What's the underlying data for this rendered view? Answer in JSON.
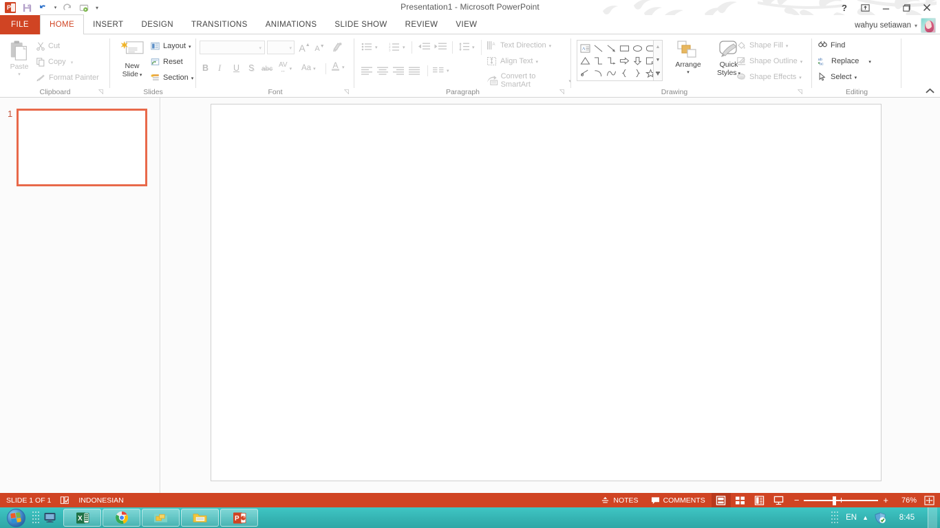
{
  "window": {
    "title": "Presentation1 - Microsoft PowerPoint",
    "app_icon": "powerpoint-icon",
    "help_icon": "?",
    "ribbon_display_icon": "ribbon-display-options-icon",
    "minimize_icon": "minimize-icon",
    "restore_icon": "restore-icon",
    "close_icon": "close-icon",
    "accent_color": "#d04423",
    "taskbar_color": "#36b5b4"
  },
  "quick_access": {
    "items": [
      {
        "name": "save-icon",
        "label": "Save"
      },
      {
        "name": "undo-icon",
        "label": "Undo"
      },
      {
        "name": "undo-dropdown-icon",
        "label": "Undo options"
      },
      {
        "name": "redo-icon",
        "label": "Redo"
      },
      {
        "name": "start-slideshow-icon",
        "label": "Start From Beginning"
      },
      {
        "name": "customize-qat-icon",
        "label": "Customize Quick Access Toolbar"
      }
    ]
  },
  "account": {
    "user_name": "wahyu setiawan",
    "caret": "▾",
    "avatar": "user-avatar"
  },
  "tabs": {
    "file": "FILE",
    "items": [
      {
        "label": "HOME",
        "active": true
      },
      {
        "label": "INSERT",
        "active": false
      },
      {
        "label": "DESIGN",
        "active": false
      },
      {
        "label": "TRANSITIONS",
        "active": false
      },
      {
        "label": "ANIMATIONS",
        "active": false
      },
      {
        "label": "SLIDE SHOW",
        "active": false
      },
      {
        "label": "REVIEW",
        "active": false
      },
      {
        "label": "VIEW",
        "active": false
      }
    ]
  },
  "ribbon": {
    "collapse_icon": "collapse-ribbon-icon",
    "clipboard": {
      "label": "Clipboard",
      "paste": "Paste",
      "cut": "Cut",
      "copy": "Copy",
      "format_painter": "Format Painter"
    },
    "slides": {
      "label": "Slides",
      "new_slide_line1": "New",
      "new_slide_line2": "Slide",
      "layout": "Layout",
      "reset": "Reset",
      "section": "Section"
    },
    "font": {
      "label": "Font",
      "font_name_value": "",
      "font_size_value": "",
      "grow_font": "A",
      "shrink_font": "A",
      "clear_formatting": "clear-formatting-icon",
      "bold": "B",
      "italic": "I",
      "underline": "U",
      "shadow": "S",
      "strikethrough": "abc",
      "character_spacing": "AV",
      "change_case": "Aa",
      "font_color": "A"
    },
    "paragraph": {
      "label": "Paragraph",
      "bullets": "bullets-icon",
      "numbering": "numbering-icon",
      "decrease_indent": "decrease-indent-icon",
      "increase_indent": "increase-indent-icon",
      "line_spacing": "line-spacing-icon",
      "align_left": "align-left-icon",
      "align_center": "align-center-icon",
      "align_right": "align-right-icon",
      "justify": "justify-icon",
      "columns": "columns-icon",
      "text_direction": "Text Direction",
      "align_text": "Align Text",
      "convert_smartart": "Convert to SmartArt"
    },
    "drawing": {
      "label": "Drawing",
      "shapes": [
        "textbox-shape",
        "line-shape",
        "arrow-shape",
        "rectangle-shape",
        "oval-shape",
        "rounded-rectangle-shape",
        "triangle-shape",
        "elbow-connector-shape",
        "elbow-arrow-shape",
        "right-arrow-shape",
        "down-arrow-shape",
        "folded-corner-shape",
        "scribble-shape",
        "arc-shape",
        "curve-shape",
        "left-brace-shape",
        "right-brace-shape",
        "star-shape"
      ],
      "scroll_up_icon": "gallery-scroll-up-icon",
      "scroll_down_icon": "gallery-scroll-down-icon",
      "gallery_more_icon": "gallery-more-icon",
      "arrange": "Arrange",
      "quick_styles_line1": "Quick",
      "quick_styles_line2": "Styles",
      "shape_fill": "Shape Fill",
      "shape_outline": "Shape Outline",
      "shape_effects": "Shape Effects"
    },
    "editing": {
      "label": "Editing",
      "find": "Find",
      "replace": "Replace",
      "select": "Select"
    }
  },
  "slides_pane": {
    "thumbnail_number": "1"
  },
  "status_bar": {
    "slide_count": "SLIDE 1 OF 1",
    "spellcheck_icon": "spellcheck-icon",
    "language": "INDONESIAN",
    "notes": "NOTES",
    "notes_icon": "notes-icon",
    "comments": "COMMENTS",
    "comments_icon": "comments-icon",
    "views": [
      {
        "name": "normal-view-button",
        "label": "Normal",
        "active": true
      },
      {
        "name": "slide-sorter-view-button",
        "label": "Slide Sorter",
        "active": false
      },
      {
        "name": "reading-view-button",
        "label": "Reading View",
        "active": false
      },
      {
        "name": "slide-show-button",
        "label": "Slide Show",
        "active": false
      }
    ],
    "zoom_out": "−",
    "zoom_in": "+",
    "zoom_level": "76%",
    "fit_to_window_icon": "fit-slide-to-window-icon"
  },
  "taskbar": {
    "start_label": "Start",
    "show_desktop_icon": "show-desktop-icon",
    "quick_launch": [
      {
        "name": "show-desktop-quicklaunch-icon",
        "label": "Show desktop"
      }
    ],
    "apps": [
      {
        "name": "taskbar-excel",
        "label": "Microsoft Excel"
      },
      {
        "name": "taskbar-chrome",
        "label": "Google Chrome"
      },
      {
        "name": "taskbar-folder-yellow",
        "label": "Folder"
      },
      {
        "name": "taskbar-explorer",
        "label": "Windows Explorer"
      },
      {
        "name": "taskbar-powerpoint",
        "label": "Microsoft PowerPoint"
      }
    ],
    "tray": {
      "language": "EN",
      "show_hidden_icon": "show-hidden-icons-icon",
      "security_icon": "security-shield-icon",
      "time": "8:45"
    }
  }
}
